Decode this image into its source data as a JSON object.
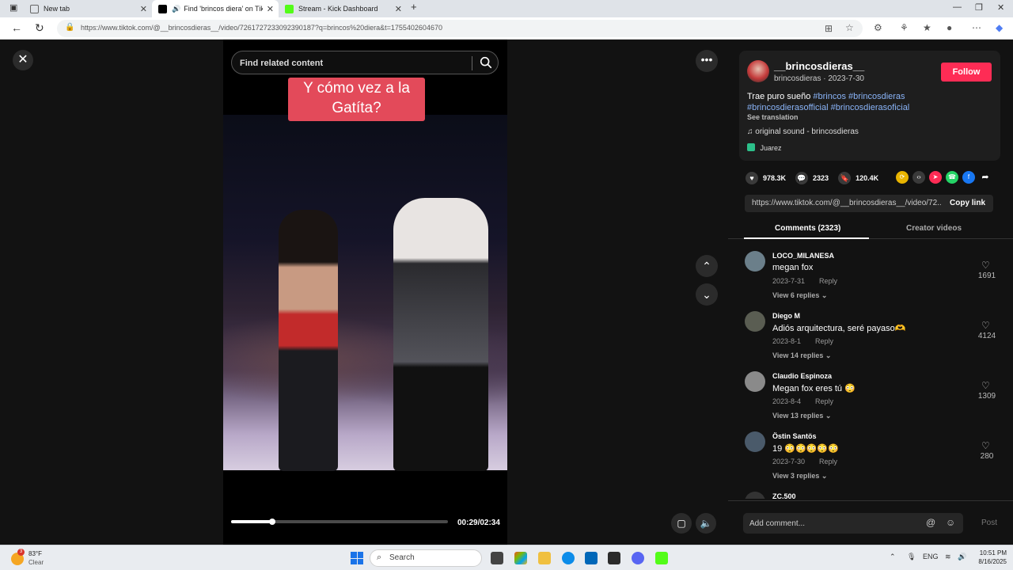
{
  "browser": {
    "tabs": [
      {
        "title": "New tab"
      },
      {
        "title": "Find 'brincos diera' on TikTo"
      },
      {
        "title": "Stream - Kick Dashboard"
      }
    ],
    "url": "https://www.tiktok.com/@__brincosdieras__/video/7261727233092390187?q=brincos%20diera&t=1755402604670"
  },
  "player": {
    "search_placeholder": "Find related content",
    "caption": "Y cómo vez a la Gatíta?",
    "time": "00:29/02:34",
    "progress": 0.19
  },
  "author": {
    "username": "__brincosdieras__",
    "subline": "brincosdieras · 2023-7-30",
    "follow_label": "Follow",
    "desc_text": "Trae puro sueño ",
    "hashtags": [
      "#brincos",
      "#brincosdieras",
      "#brincosdierasofficial",
      "#brincosdierasoficial"
    ],
    "see_translation": "See translation",
    "music": "original sound - brincosdieras",
    "location": "Juarez"
  },
  "stats": {
    "likes": "978.3K",
    "comments": "2323",
    "saves": "120.4K"
  },
  "share": {
    "link": "https://www.tiktok.com/@__brincosdieras__/video/72...",
    "copy_label": "Copy link"
  },
  "panel_tabs": {
    "comments": "Comments (2323)",
    "creator": "Creator videos"
  },
  "comments": [
    {
      "user": "LOCO_MILANESA",
      "text": "megan fox",
      "date": "2023-7-31",
      "reply": "Reply",
      "replies": "View 6 replies",
      "likes": "1691"
    },
    {
      "user": "Diego M",
      "text": "Adiós arquitectura, seré payaso🫶",
      "date": "2023-8-1",
      "reply": "Reply",
      "replies": "View 14 replies",
      "likes": "4124"
    },
    {
      "user": "Claudio Espinoza",
      "text": "Megan fox eres tú 😳",
      "date": "2023-8-4",
      "reply": "Reply",
      "replies": "View 13 replies",
      "likes": "1309"
    },
    {
      "user": "Östin Santös",
      "text": "19 😳😳😳😳😳",
      "date": "2023-7-30",
      "reply": "Reply",
      "replies": "View 3 replies",
      "likes": "280"
    },
    {
      "user": "ZC.500",
      "text": "",
      "date": "",
      "reply": "",
      "replies": "",
      "likes": ""
    }
  ],
  "add_comment": {
    "placeholder": "Add comment...",
    "post_label": "Post"
  },
  "taskbar": {
    "weather_temp": "83°F",
    "weather_badge": "3",
    "weather_cond": "Clear",
    "search_label": "Search",
    "lang": "ENG",
    "time": "10:51 PM",
    "date": "8/16/2025"
  }
}
